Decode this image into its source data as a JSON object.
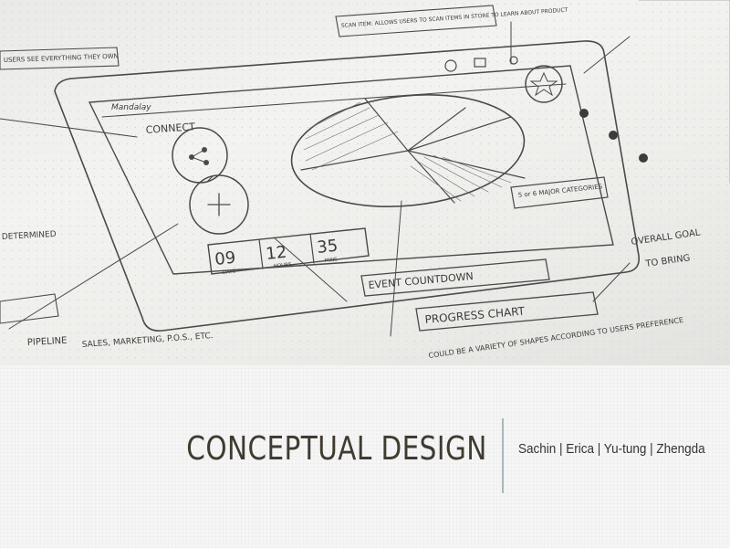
{
  "slide": {
    "title": "CONCEPTUAL DESIGN",
    "authors": "Sachin | Erica | Yu-tung | Zhengda"
  },
  "sketch": {
    "logo": "Mandalay",
    "connect_label": "CONNECT",
    "countdown": {
      "days_value": "09",
      "days_label": "DAYS",
      "hours_value": "12",
      "hours_label": "HOURS",
      "mins_value": "35",
      "mins_label": "MINS"
    },
    "notes": {
      "event_countdown": "EVENT COUNTDOWN",
      "progress_chart": "PROGRESS CHART",
      "pie_note": "5 or 6 MAJOR CATEGORIES",
      "overall_goal": "OVERALL GOAL",
      "scan_item": "SCAN ITEM: ALLOWS USERS TO SCAN ITEMS IN STORE TO LEARN ABOUT PRODUCT",
      "left_note": "USERS SEE EVERYTHING THEY OWN",
      "marketing": "SALES, MARKETING, P.O.S., ETC.",
      "could_be": "COULD BE A VARIETY OF SHAPES ACCORDING TO USERS PREFERENCE",
      "to_bring": "TO BRING",
      "determined": "DETERMINED",
      "pipeline": "PIPELINE"
    }
  },
  "colors": {
    "title": "#3f3b31",
    "divider": "#a9b8bc",
    "band": "#f6f6f6"
  }
}
